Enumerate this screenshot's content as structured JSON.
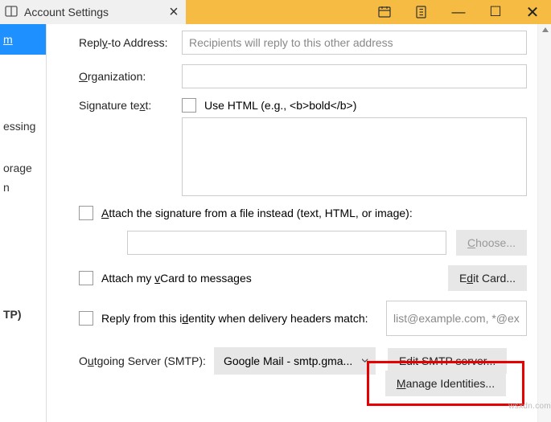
{
  "title": "Account Settings",
  "window_buttons": {
    "minimize": "—",
    "maximize": "☐",
    "close": "✕"
  },
  "toolbar_icons": {
    "calendar": "calendar",
    "addressbook": "addressbook"
  },
  "sidebar": {
    "items": [
      {
        "label": "m",
        "selected": true
      },
      {
        "label": "essing"
      },
      {
        "label": "orage"
      },
      {
        "label": "n"
      },
      {
        "label": "TP)"
      }
    ]
  },
  "form": {
    "reply_to_label_pre": "Repl",
    "reply_to_label_u": "y",
    "reply_to_label_post": "-to Address:",
    "reply_to_placeholder": "Recipients will reply to this other address",
    "org_label_u": "O",
    "org_label_post": "rganization:",
    "sig_label_pre": "Signature te",
    "sig_label_u": "x",
    "sig_label_post": "t:",
    "use_html_label": "Use HTML (e.g., <b>bold</b>)",
    "attach_sig_label_u": "A",
    "attach_sig_label_post": "ttach the signature from a file instead (text, HTML, or image):",
    "choose_label_u": "C",
    "choose_label_post": "hoose...",
    "vcard_pre": "Attach my ",
    "vcard_u": "v",
    "vcard_post": "Card to messages",
    "editcard_pre": "E",
    "editcard_u": "d",
    "editcard_post": "it Card...",
    "reply_identity_pre": "Reply from this i",
    "reply_identity_u": "d",
    "reply_identity_post": "entity when delivery headers match:",
    "identity_placeholder": "list@example.com, *@ex",
    "smtp_label_pre": "O",
    "smtp_label_u": "u",
    "smtp_label_post": "tgoing Server (SMTP):",
    "smtp_value": "Google Mail - smtp.gma...",
    "edit_smtp": "Edit SMTP server...",
    "manage_u": "M",
    "manage_post": "anage Identities..."
  },
  "watermark": "wsxdn.com"
}
